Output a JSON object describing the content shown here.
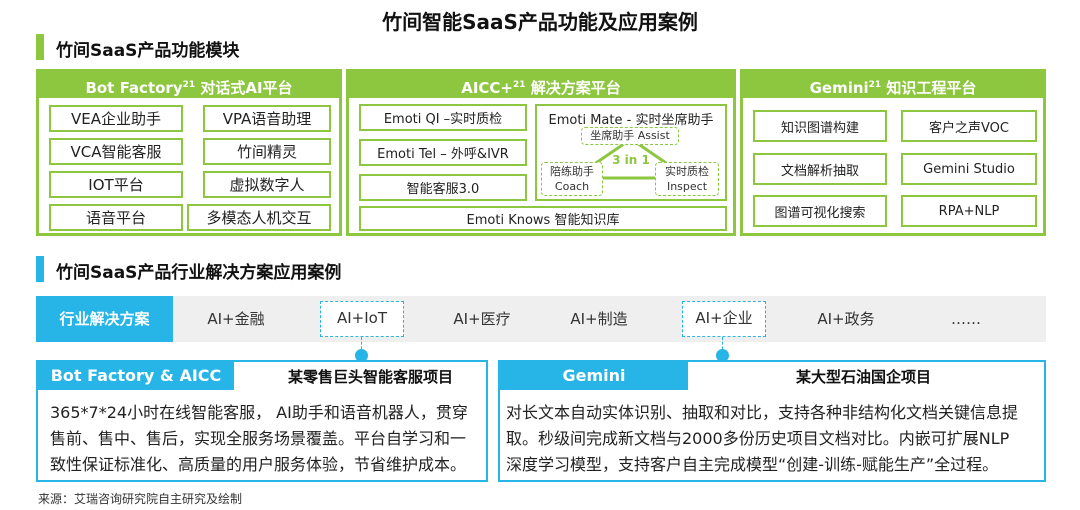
{
  "title": "竹间智能SaaS产品功能及应用案例",
  "section1": {
    "title": "竹间SaaS产品功能模块"
  },
  "bot_factory": {
    "header_main": "Bot Factory",
    "header_sup": "21",
    "header_tail": " 对话式AI平台",
    "items": [
      "VEA企业助手",
      "VPA语音助理",
      "VCA智能客服",
      "竹间精灵",
      "IOT平台",
      "虚拟数字人",
      "语音平台",
      "多模态人机交互"
    ]
  },
  "aicc": {
    "header_main": "AICC+",
    "header_sup": "21",
    "header_tail": " 解决方案平台",
    "left_items": [
      "Emoti QI –实时质检",
      "Emoti Tel – 外呼&IVR",
      "智能客服3.0"
    ],
    "mate_title": "Emoti Mate - 实时坐席助手",
    "assist_label": "坐席助手 Assist",
    "coach_label_1": "陪练助手",
    "coach_label_2": "Coach",
    "inspect_label_1": "实时质检",
    "inspect_label_2": "Inspect",
    "three_in_one": "3 in 1",
    "knows": "Emoti Knows 智能知识库"
  },
  "gemini_panel": {
    "header_main": "Gemini",
    "header_sup": "21",
    "header_tail": " 知识工程平台",
    "items": [
      "知识图谱构建",
      "客户之声VOC",
      "文档解析抽取",
      "Gemini Studio",
      "图谱可视化搜索",
      "RPA+NLP"
    ]
  },
  "section2": {
    "title": "竹间SaaS产品行业解决方案应用案例"
  },
  "tabs": {
    "first": "行业解决方案",
    "items": [
      "AI+金融",
      "AI+IoT",
      "AI+医疗",
      "AI+制造",
      "AI+企业",
      "AI+政务",
      "……"
    ]
  },
  "case_left": {
    "label": "Bot Factory & AICC",
    "heading": "某零售巨头智能客服项目",
    "lines": [
      "365*7*24小时在线智能客服， AI助手和语音机器人，贯穿",
      "售前、售中、售后，实现全服务场景覆盖。平台自学习和一",
      "致性保证标准化、高质量的用户服务体验，节省维护成本。"
    ]
  },
  "case_right": {
    "label": "Gemini",
    "heading": "某大型石油国企项目",
    "lines": [
      "对长文本自动实体识别、抽取和对比，支持各种非结构化文档关键信息提",
      "取。秒级间完成新文档与2000多份历史项目文档对比。内嵌可扩展NLP",
      "深度学习模型，支持客户自主完成模型“创建-训练-赋能生产”全过程。"
    ]
  },
  "source": "来源：艾瑞咨询研究院自主研究及绘制",
  "colors": {
    "green": "#8dc63f",
    "blue": "#27b4e6"
  }
}
